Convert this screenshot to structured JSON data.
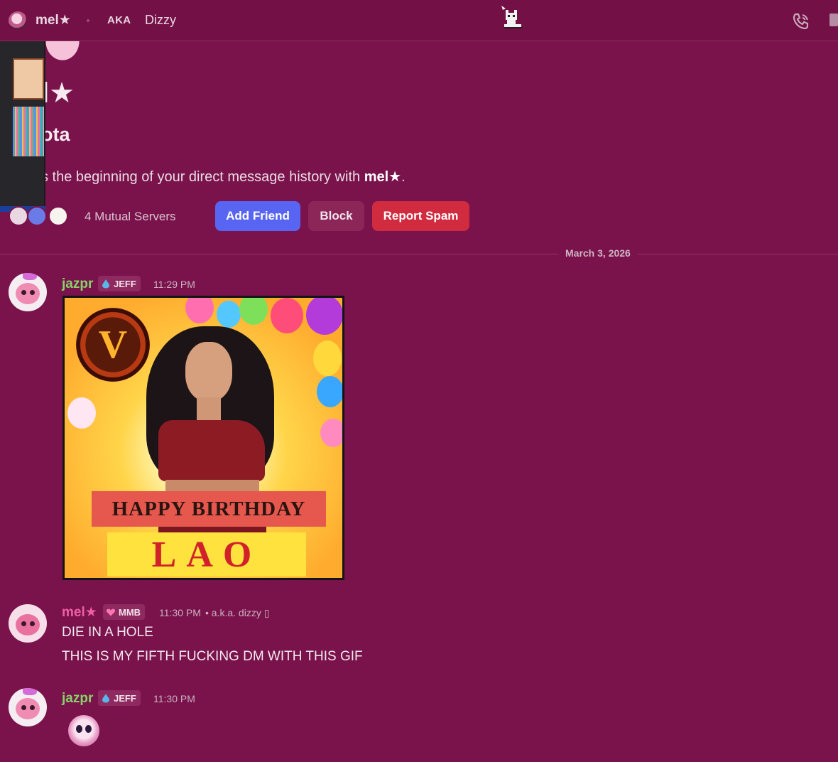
{
  "topbar": {
    "name": "mel★",
    "aka_label": "AKA",
    "aka_value": "Dizzy"
  },
  "profile": {
    "display_name": "l★",
    "username": "ota",
    "intro_prefix": "s the beginning of your direct message history with ",
    "intro_name": "mel★",
    "intro_suffix": ".",
    "mutual_servers": "4 Mutual Servers"
  },
  "actions": {
    "add_friend": "Add Friend",
    "block": "Block",
    "report_spam": "Report Spam"
  },
  "date_divider": "March 3, 2026",
  "messages": [
    {
      "author": "jazpr",
      "tag": "JEFF",
      "time": "11:29 PM",
      "gif": {
        "banner": "HAPPY BIRTHDAY",
        "name": "LAO",
        "logo_letter": "V"
      }
    },
    {
      "author": "mel★",
      "tag": "MMB",
      "time": "11:30 PM",
      "meta": "• a.k.a. dizzy ▯",
      "lines": [
        "DIE IN A HOLE",
        "THIS IS MY FIFTH FUCKING DM WITH THIS GIF"
      ]
    },
    {
      "author": "jazpr",
      "tag": "JEFF",
      "time": "11:30 PM"
    }
  ],
  "colors": {
    "background": "#7a134b",
    "jazpr": "#87d36a",
    "mel": "#ef5fa6",
    "add_friend": "#5865f2",
    "report_spam": "#d12b3f"
  }
}
